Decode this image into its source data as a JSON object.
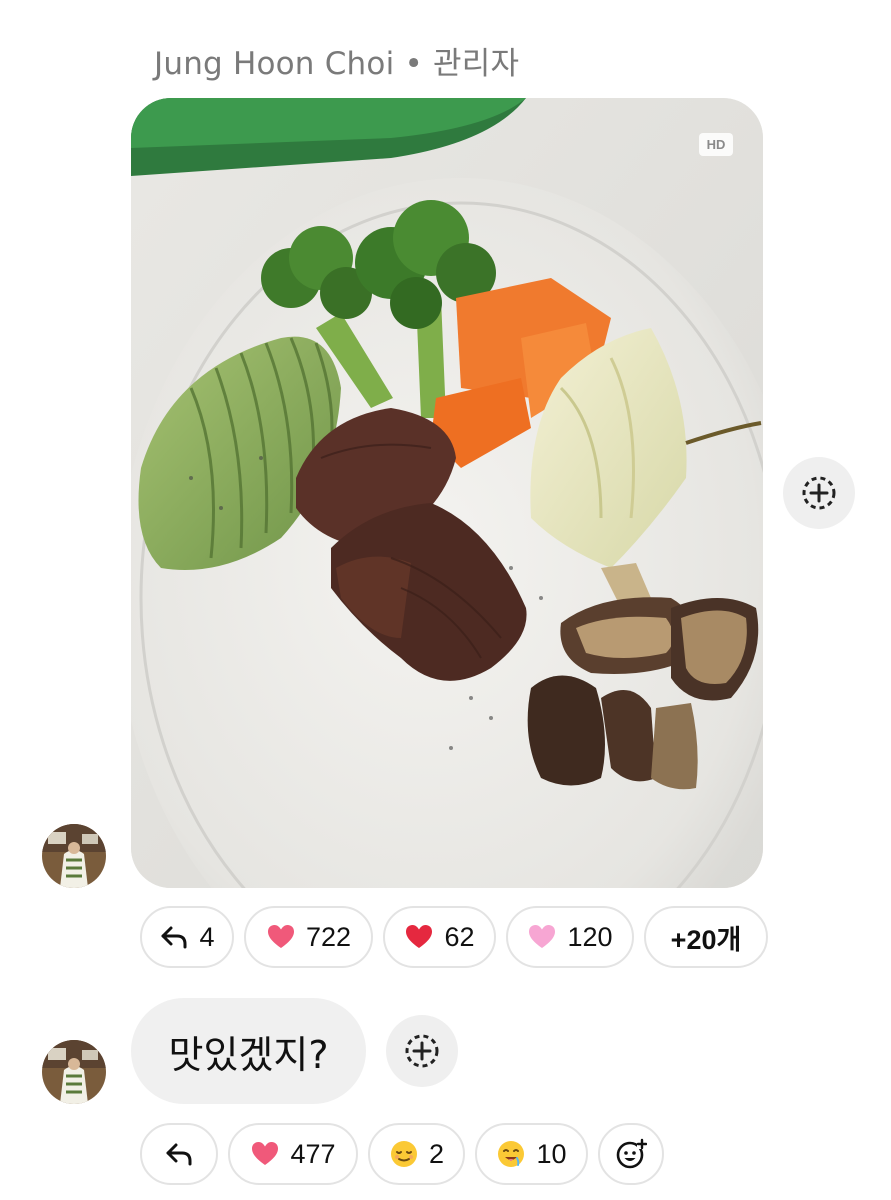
{
  "message1": {
    "sender_name": "Jung Hoon Choi",
    "separator": "•",
    "sender_role": "관리자",
    "hd_badge": "HD",
    "reactions": [
      {
        "icon": "reply-arrow-icon",
        "count": "4"
      },
      {
        "icon": "pink-heart-icon",
        "count": "722"
      },
      {
        "icon": "red-heart-icon",
        "count": "62"
      },
      {
        "icon": "light-pink-heart-icon",
        "count": "120"
      },
      {
        "icon": "",
        "count": "+20개"
      }
    ]
  },
  "message2": {
    "text": "맛있겠지?",
    "reactions": [
      {
        "icon": "reply-arrow-icon",
        "count": ""
      },
      {
        "icon": "pink-heart-icon",
        "count": "477"
      },
      {
        "icon": "relieved-face-emoji",
        "count": "2"
      },
      {
        "icon": "drooling-face-emoji",
        "count": "10"
      },
      {
        "icon": "add-emoji-icon",
        "count": ""
      }
    ]
  },
  "colors": {
    "name_gray": "#7a7a7a",
    "chip_border": "#e3e3e3",
    "bubble_bg": "#f0f0f0",
    "heart_pink": "#f0597a",
    "heart_red": "#e5283f",
    "heart_light": "#f7a6d3"
  }
}
